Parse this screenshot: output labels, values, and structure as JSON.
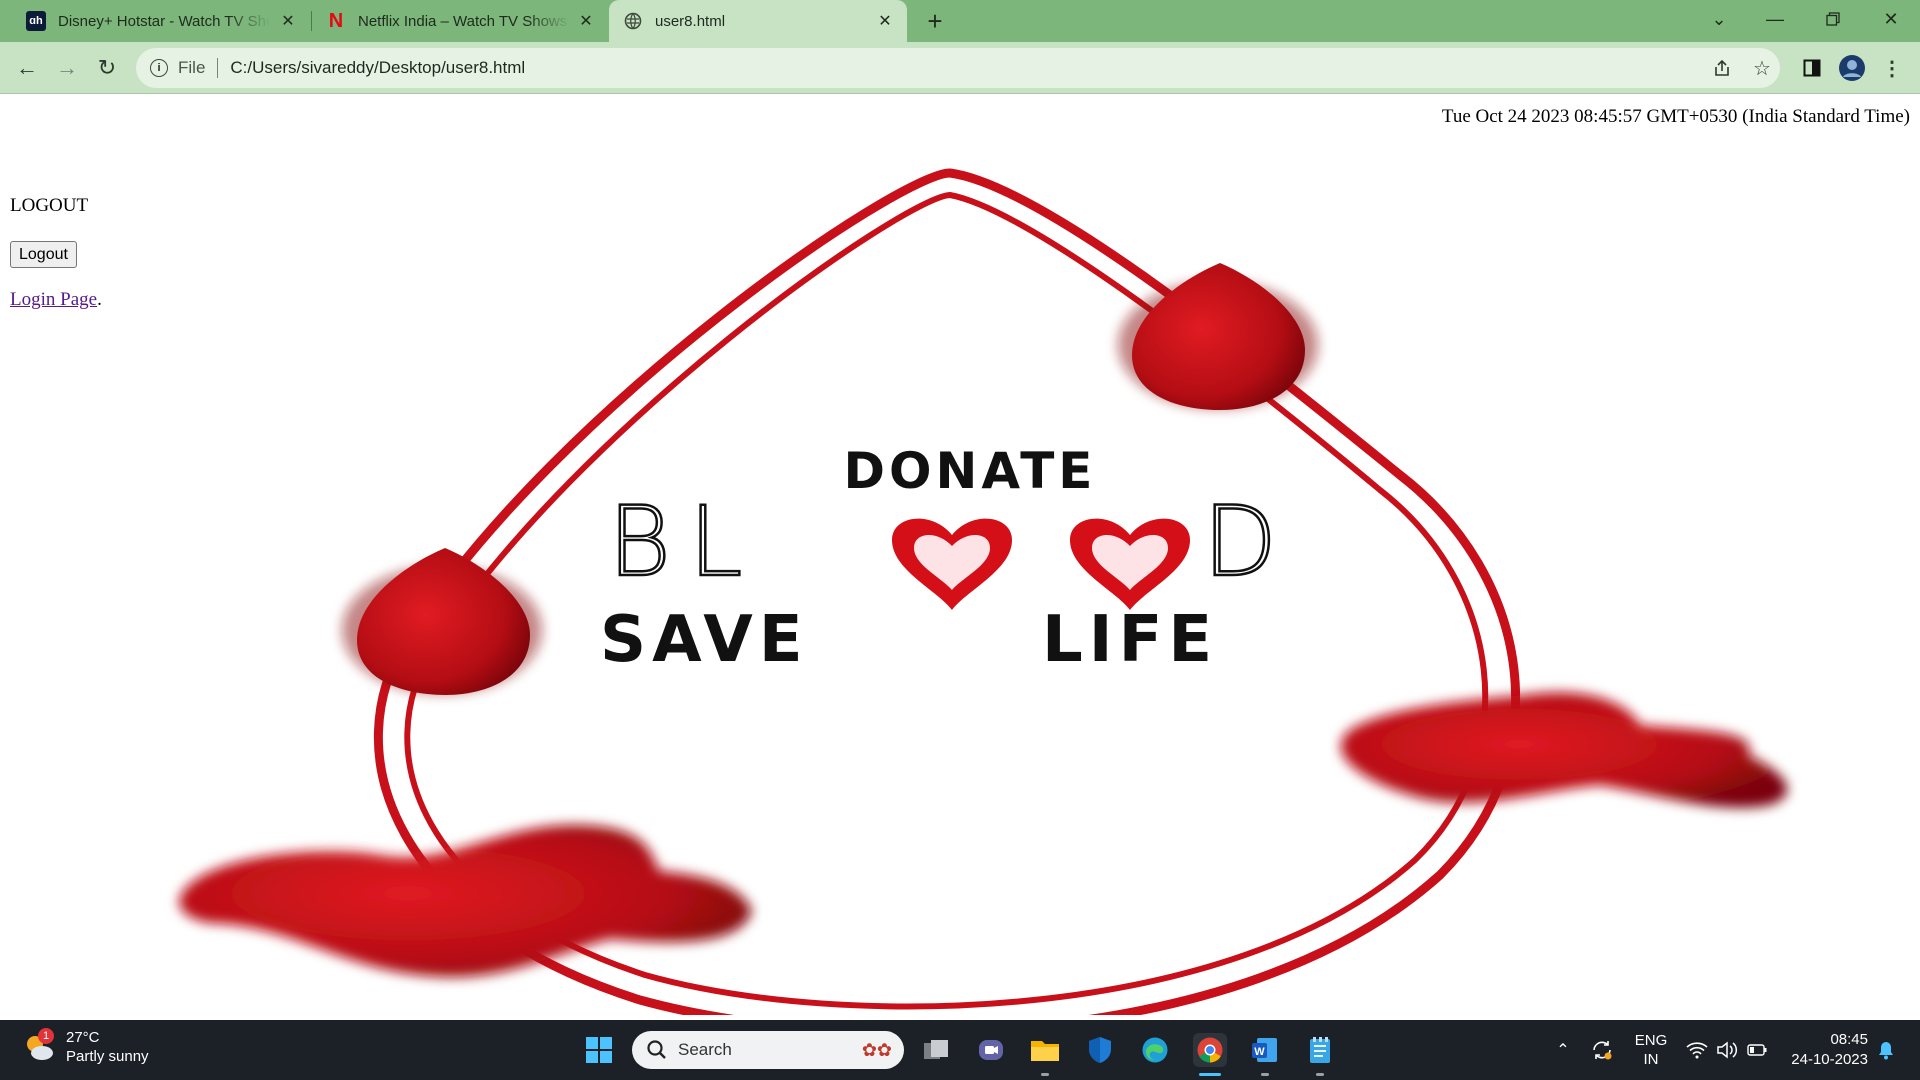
{
  "browser": {
    "tabs": [
      {
        "title": "Disney+ Hotstar - Watch TV Shows",
        "icon": "hotstar-icon",
        "active": false
      },
      {
        "title": "Netflix India – Watch TV Shows Online",
        "icon": "netflix-icon",
        "active": false
      },
      {
        "title": "user8.html",
        "icon": "globe-icon",
        "active": true
      }
    ],
    "url_scheme": "File",
    "url": "C:/Users/sivareddy/Desktop/user8.html",
    "colors": {
      "frame": "#7cb67a",
      "toolbar": "#c8e2c4"
    }
  },
  "page": {
    "datetime": "Tue Oct 24 2023 08:45:57 GMT+0530 (India Standard Time)",
    "logout_heading": "LOGOUT",
    "logout_button": "Logout",
    "login_link": "Login Page",
    "login_suffix": ".",
    "image": {
      "line1": "DONATE",
      "line2_left": "BL",
      "line2_right": "D",
      "line3_left": "SAVE",
      "line3_right": "LIFE",
      "accent": "#c8101a"
    }
  },
  "taskbar": {
    "weather_temp": "27°C",
    "weather_desc": "Partly sunny",
    "weather_badge": "1",
    "search_placeholder": "Search",
    "lang_top": "ENG",
    "lang_bottom": "IN",
    "time": "08:45",
    "date": "24-10-2023"
  }
}
